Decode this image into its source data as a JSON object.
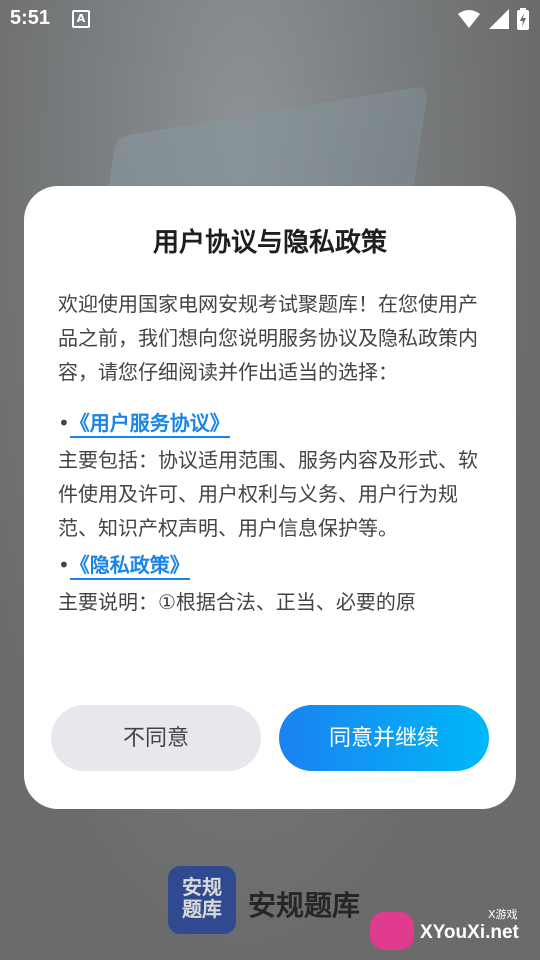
{
  "status_bar": {
    "time": "5:51",
    "notification_icon": "A"
  },
  "dialog": {
    "title": "用户协议与隐私政策",
    "intro": "欢迎使用国家电网安规考试聚题库！在您使用产品之前，我们想向您说明服务协议及隐私政策内容，请您仔细阅读并作出适当的选择：",
    "sections": [
      {
        "bullet": "•",
        "link": "《用户服务协议》",
        "text": "主要包括：协议适用范围、服务内容及形式、软件使用及许可、用户权利与义务、用户行为规范、知识产权声明、用户信息保护等。"
      },
      {
        "bullet": "•",
        "link": "《隐私政策》",
        "text": "主要说明：①根据合法、正当、必要的原"
      }
    ],
    "buttons": {
      "disagree": "不同意",
      "agree": "同意并继续"
    }
  },
  "brand": {
    "logo_line1": "安规",
    "logo_line2": "题库",
    "name": "安规题库"
  },
  "watermark": {
    "main": "XYouXi.net",
    "small": "X游戏"
  },
  "colors": {
    "link": "#1b84e8",
    "agree_start": "#1a82f2",
    "agree_end": "#00b8f8",
    "disagree_bg": "#e7e8ee"
  }
}
